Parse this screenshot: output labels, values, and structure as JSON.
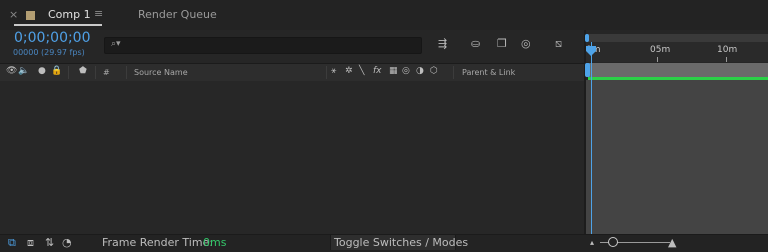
{
  "tabs": {
    "comp": {
      "close": "×",
      "title": "Comp 1",
      "menu": "≡"
    },
    "render_queue": {
      "title": "Render Queue"
    }
  },
  "timecode": "0;00;00;00",
  "fps_label": "00000 (29.97 fps)",
  "search": {
    "icon": "⌕▾",
    "placeholder": ""
  },
  "toolbar": {
    "tools": [
      "⇶",
      "⛀",
      "❐",
      "◎",
      "⧅"
    ]
  },
  "column_header": {
    "switch_icons": [
      "👁",
      "🔈",
      "●",
      "🔒"
    ],
    "label_icon": "⬟",
    "hash": "#",
    "source_name": "Source Name",
    "layer_switch_icons": [
      "⚹",
      "✲",
      "╲",
      "fx",
      "▦",
      "◎",
      "◑",
      "⬡"
    ],
    "parent_link": "Parent & Link"
  },
  "ruler": {
    "labels": [
      "0m",
      "05m",
      "10m"
    ]
  },
  "bottom_bar": {
    "left_icons": [
      "⧉",
      "⧈",
      "⇅",
      "◔"
    ],
    "frame_render_label": "Frame Render Time:",
    "frame_render_value": "0ms",
    "toggle_label": "Toggle Switches / Modes",
    "zoom_out_icon": "▴",
    "zoom_in_icon": "▲"
  },
  "colors": {
    "accent": "#4ea3e8",
    "work_area_green": "#2bd047",
    "render_time": "#34c76a",
    "timecode": "#4fa0e6"
  }
}
